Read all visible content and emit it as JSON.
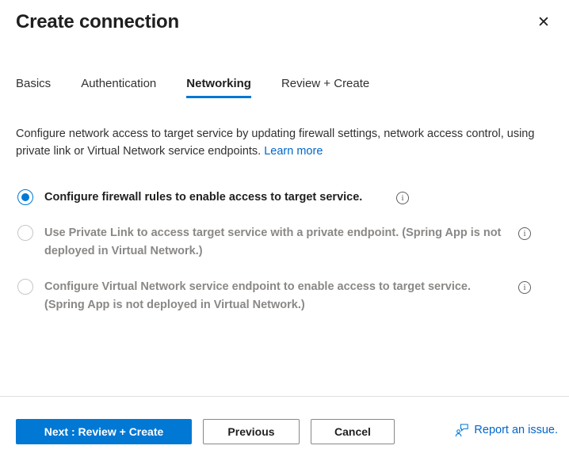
{
  "header": {
    "title": "Create connection",
    "close_label": "✕"
  },
  "tabs": [
    {
      "label": "Basics",
      "selected": false
    },
    {
      "label": "Authentication",
      "selected": false
    },
    {
      "label": "Networking",
      "selected": true
    },
    {
      "label": "Review + Create",
      "selected": false
    }
  ],
  "description": {
    "text": "Configure network access to target service by updating firewall settings, network access control, using private link or Virtual Network service endpoints.",
    "link_label": "Learn more"
  },
  "options": [
    {
      "label": "Configure firewall rules to enable access to target service.",
      "selected": true,
      "disabled": false,
      "info_label": "i"
    },
    {
      "label": "Use Private Link to access target service with a private endpoint. (Spring App is not deployed in Virtual Network.)",
      "selected": false,
      "disabled": true,
      "info_label": "i"
    },
    {
      "label": "Configure Virtual Network service endpoint to enable access to target service. (Spring App is not deployed in Virtual Network.)",
      "selected": false,
      "disabled": true,
      "info_label": "i"
    }
  ],
  "footer": {
    "next_label": "Next : Review + Create",
    "previous_label": "Previous",
    "cancel_label": "Cancel",
    "report_issue_label": "Report an issue."
  },
  "colors": {
    "accent": "#0078d4",
    "link": "#0066cc",
    "text": "#323130",
    "disabled_text": "#8a8886",
    "divider": "#e1dfdd"
  }
}
